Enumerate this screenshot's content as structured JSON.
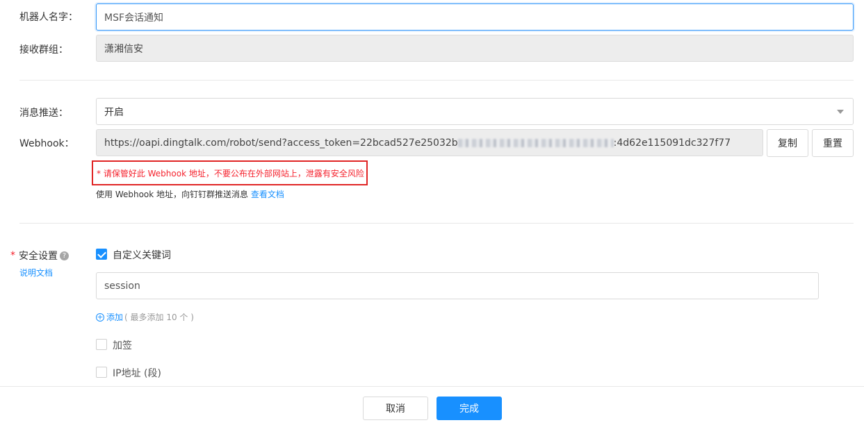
{
  "robot_name": {
    "label": "机器人名字：",
    "value": "MSF会话通知"
  },
  "group": {
    "label": "接收群组：",
    "value": "潇湘信安"
  },
  "push": {
    "label": "消息推送：",
    "value": "开启"
  },
  "webhook": {
    "label": "Webhook：",
    "url_prefix": "https://oapi.dingtalk.com/robot/send?access_token=22bcad527e25032b",
    "url_suffix": ":4d62e115091dc327f77",
    "copy_label": "复制",
    "reset_label": "重置",
    "warning": "* 请保管好此 Webhook 地址，不要公布在外部网站上，泄露有安全风险",
    "usage_text": "使用 Webhook 地址，向钉钉群推送消息",
    "doc_link": "查看文档"
  },
  "security": {
    "required_mark": "*",
    "label": "安全设置",
    "help_link": "说明文档",
    "keyword": {
      "label": "自定义关键词",
      "checked": true,
      "value": "session"
    },
    "add_link": "添加",
    "add_hint": "( 最多添加 10 个 )",
    "sign": {
      "label": "加签",
      "checked": false
    },
    "ip": {
      "label": "IP地址 (段)",
      "checked": false
    }
  },
  "footer": {
    "cancel_label": "取消",
    "done_label": "完成"
  },
  "colors": {
    "accent": "#1890ff",
    "warning": "#f5222d",
    "required": "#f5222d"
  }
}
